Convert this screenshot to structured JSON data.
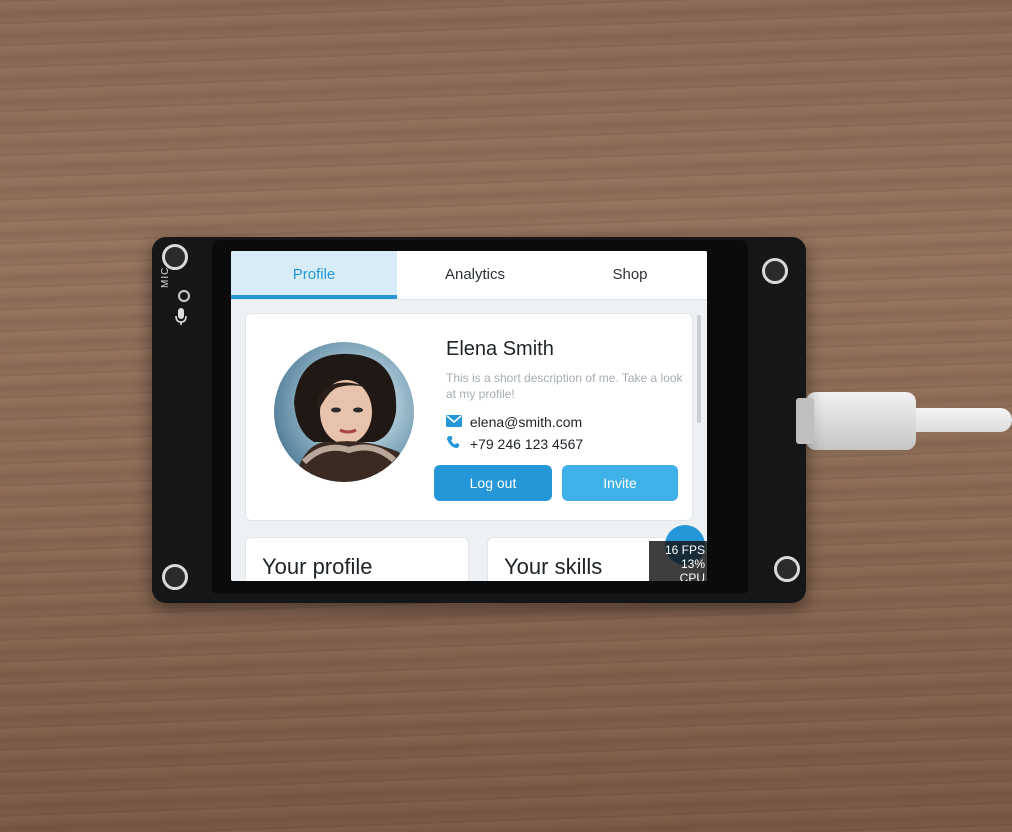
{
  "tabs": [
    {
      "label": "Profile",
      "active": true
    },
    {
      "label": "Analytics",
      "active": false
    },
    {
      "label": "Shop",
      "active": false
    }
  ],
  "profile": {
    "name": "Elena Smith",
    "description": "This is a short description of me. Take a look at my profile!",
    "email": "elena@smith.com",
    "phone": "+79 246 123 4567",
    "logout_label": "Log out",
    "invite_label": "Invite"
  },
  "cards": {
    "your_profile": "Your profile",
    "your_skills": "Your skills"
  },
  "perf": {
    "fps": "16 FPS",
    "cpu": "13% CPU"
  },
  "device": {
    "mic_label": "MIC"
  },
  "colors": {
    "accent": "#2596d8",
    "accent_light": "#40b1e6",
    "tab_active_bg": "#d8ecf7",
    "screen_bg": "#eef1f4"
  },
  "icons": {
    "email": "envelope-icon",
    "phone": "phone-icon"
  }
}
